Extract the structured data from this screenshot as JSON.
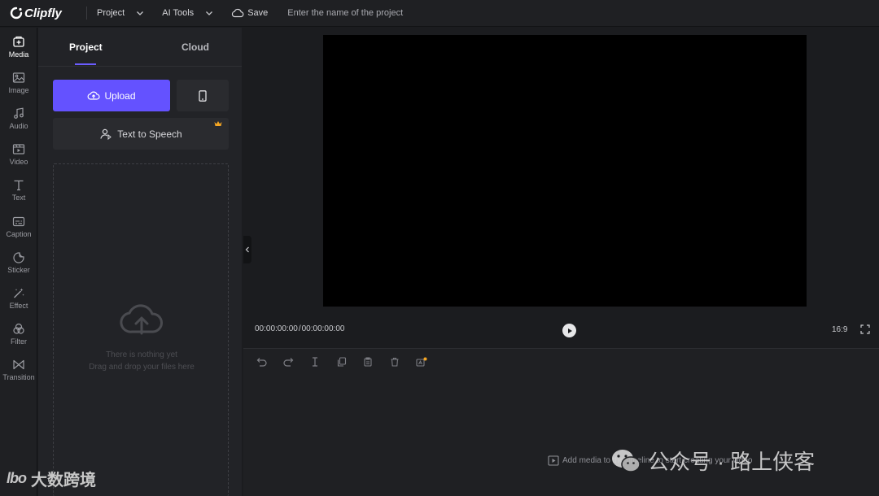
{
  "app": {
    "name": "Clipfly"
  },
  "topbar": {
    "menus": [
      {
        "label": "Project"
      },
      {
        "label": "AI Tools"
      }
    ],
    "save_label": "Save",
    "project_name_placeholder": "Enter the name of the project"
  },
  "rail": {
    "items": [
      {
        "label": "Media",
        "icon": "media-icon",
        "active": true
      },
      {
        "label": "Image",
        "icon": "image-icon"
      },
      {
        "label": "Audio",
        "icon": "music-note-icon"
      },
      {
        "label": "Video",
        "icon": "video-icon"
      },
      {
        "label": "Text",
        "icon": "text-icon"
      },
      {
        "label": "Caption",
        "icon": "caption-icon"
      },
      {
        "label": "Sticker",
        "icon": "sticker-icon"
      },
      {
        "label": "Effect",
        "icon": "magic-wand-icon"
      },
      {
        "label": "Filter",
        "icon": "filter-icon"
      },
      {
        "label": "Transition",
        "icon": "transition-icon"
      }
    ]
  },
  "panel": {
    "tabs": [
      {
        "label": "Project",
        "active": true
      },
      {
        "label": "Cloud"
      }
    ],
    "upload_label": "Upload",
    "tts_label": "Text to Speech",
    "empty_title": "There is nothing yet",
    "empty_subtitle": "Drag and drop your files here"
  },
  "preview": {
    "current_time": "00:00:00:00",
    "time_separator": "/",
    "total_time": "00:00:00:00",
    "aspect_ratio": "16:9"
  },
  "timeline": {
    "tools": [
      "undo-icon",
      "redo-icon",
      "split-icon",
      "duplicate-icon",
      "copy-icon",
      "delete-icon",
      "ai-icon"
    ],
    "hint_visible": "Add media to the timeline to start creating your video"
  },
  "watermarks": {
    "left_logo": "lbo",
    "left_text": "大数跨境",
    "right_text": "公众号 · 路上侠客"
  },
  "colors": {
    "accent": "#6452ff",
    "background": "#1b1c1f",
    "panel": "#222327",
    "crown": "#f5a623"
  }
}
